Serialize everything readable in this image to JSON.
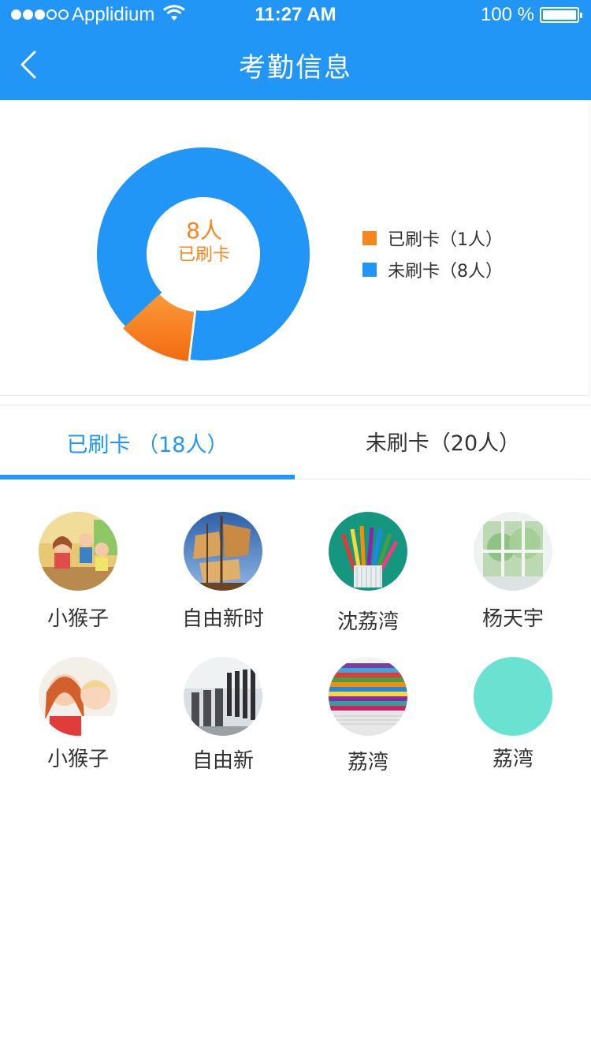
{
  "status_bar": {
    "carrier": "Applidium",
    "time": "11:27 AM",
    "battery": "100 %",
    "signal_bars": 3,
    "signal_total": 5,
    "battery_level": 1.0
  },
  "nav": {
    "title": "考勤信息",
    "back_icon": "chevron-left-icon"
  },
  "chart": {
    "center_count": "8人",
    "center_label": "已刷卡",
    "legend": [
      {
        "label": "已刷卡（1人）",
        "color": "#f6861f"
      },
      {
        "label": "未刷卡（8人）",
        "color": "#2196f7"
      }
    ]
  },
  "chart_data": {
    "type": "pie",
    "categories": [
      "已刷卡",
      "未刷卡"
    ],
    "values": [
      1,
      8
    ],
    "colors": [
      "#f6861f",
      "#2196f7"
    ],
    "legend_position": "right"
  },
  "tabs": [
    {
      "label": "已刷卡 （18人）",
      "active": true
    },
    {
      "label": "未刷卡（20人）",
      "active": false
    }
  ],
  "people": [
    {
      "name": "小猴子",
      "avatar": "kids-classroom-photo"
    },
    {
      "name": "自由新时",
      "avatar": "sailing-ship-photo"
    },
    {
      "name": "沈荔湾",
      "avatar": "colored-pencils-photo"
    },
    {
      "name": "杨天宇",
      "avatar": "window-greenery-photo"
    },
    {
      "name": "小猴子",
      "avatar": "smiling-children-photo"
    },
    {
      "name": "自由新",
      "avatar": "classroom-desks-photo"
    },
    {
      "name": "荔湾",
      "avatar": "stacked-books-photo"
    },
    {
      "name": "荔湾",
      "avatar": "teal-placeholder",
      "color": "#6ae2d2"
    }
  ],
  "colors": {
    "primary": "#2196f7",
    "accent": "#f6861f"
  }
}
